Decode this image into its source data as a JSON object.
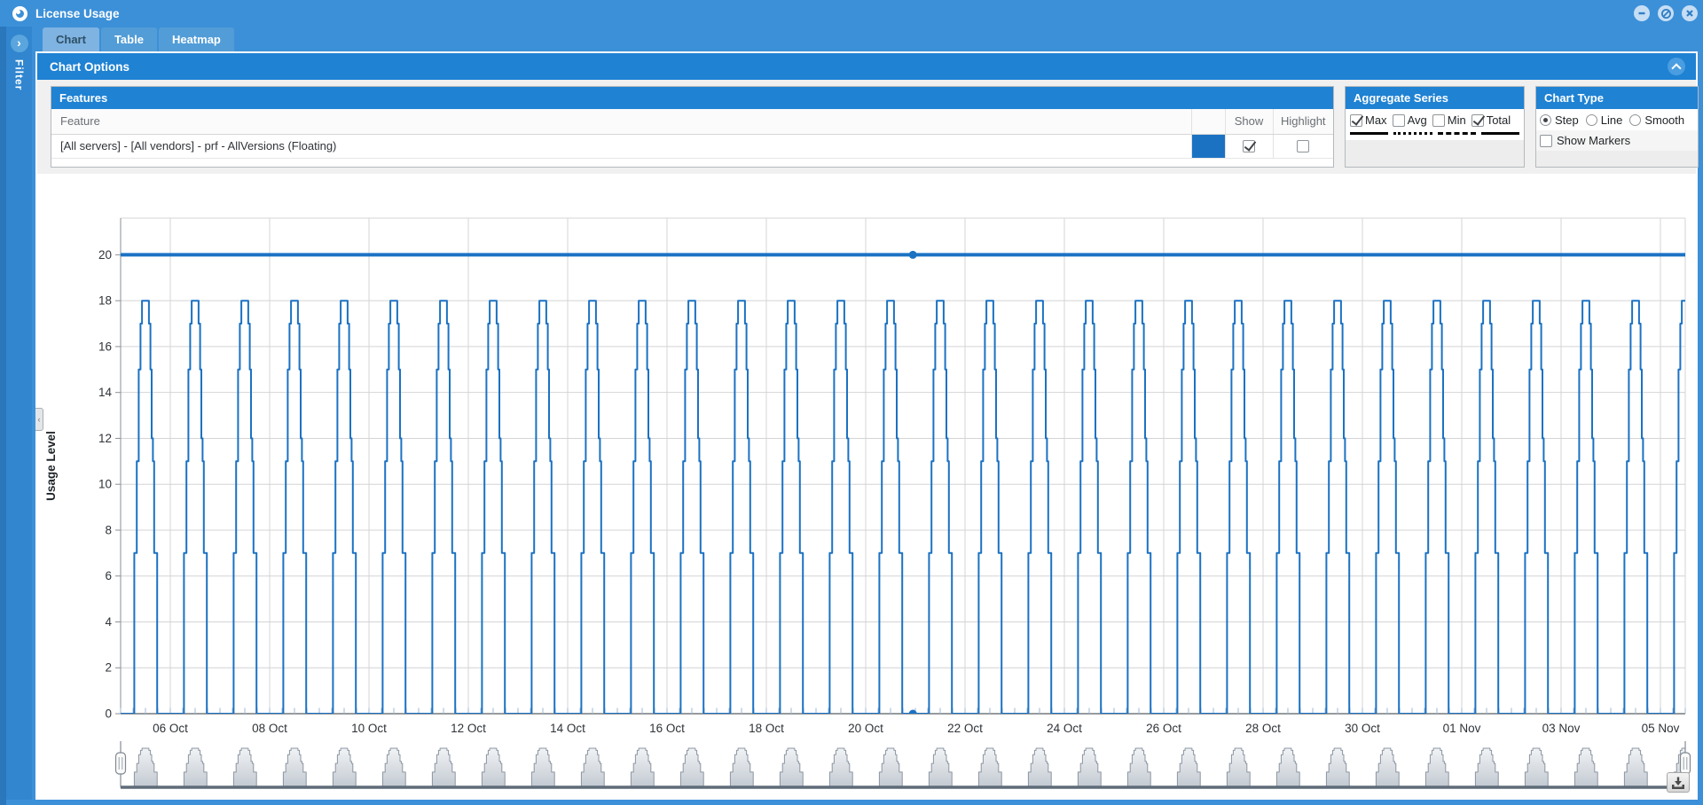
{
  "window": {
    "title": "License Usage",
    "buttons": [
      {
        "name": "minimize"
      },
      {
        "name": "maximize"
      },
      {
        "name": "close"
      }
    ]
  },
  "filter_panel": {
    "label": "Filter",
    "expand_icon": "chevron-right"
  },
  "tabs": [
    {
      "label": "Chart",
      "active": true
    },
    {
      "label": "Table",
      "active": false
    },
    {
      "label": "Heatmap",
      "active": false
    }
  ],
  "chart_options": {
    "title": "Chart Options",
    "collapse_icon": "chevron-up"
  },
  "features_panel": {
    "title": "Features",
    "columns": {
      "feature": "Feature",
      "show": "Show",
      "highlight": "Highlight"
    },
    "rows": [
      {
        "feature": "[All servers] - [All vendors] - prf - AllVersions (Floating)",
        "color": "#1b72c3",
        "show": true,
        "highlight": false
      }
    ]
  },
  "aggregate_panel": {
    "title": "Aggregate Series",
    "options": [
      {
        "label": "Max",
        "checked": true,
        "line_style": "solid"
      },
      {
        "label": "Avg",
        "checked": false,
        "line_style": "dotted"
      },
      {
        "label": "Min",
        "checked": false,
        "line_style": "dashed"
      },
      {
        "label": "Total",
        "checked": true,
        "line_style": "solid"
      }
    ]
  },
  "chart_type_panel": {
    "title": "Chart Type",
    "options": [
      {
        "label": "Step",
        "selected": true
      },
      {
        "label": "Line",
        "selected": false
      },
      {
        "label": "Smooth",
        "selected": false
      }
    ],
    "show_markers": {
      "label": "Show Markers",
      "checked": false
    }
  },
  "chart_data": {
    "type": "line",
    "subtype": "step",
    "title": "",
    "xlabel": "",
    "ylabel": "Usage Level",
    "ylim": [
      0,
      21.6
    ],
    "y_ticks": [
      0,
      2,
      4,
      6,
      8,
      10,
      12,
      14,
      16,
      18,
      20
    ],
    "x_tick_labels": [
      "06 Oct",
      "08 Oct",
      "10 Oct",
      "12 Oct",
      "14 Oct",
      "16 Oct",
      "18 Oct",
      "20 Oct",
      "22 Oct",
      "24 Oct",
      "26 Oct",
      "28 Oct",
      "30 Oct",
      "01 Nov",
      "03 Nov",
      "05 Nov"
    ],
    "x_tick_days": [
      1,
      3,
      5,
      7,
      9,
      11,
      13,
      15,
      17,
      19,
      21,
      23,
      25,
      27,
      29,
      31
    ],
    "x_range_days": [
      0,
      31.5
    ],
    "grid": true,
    "series": [
      {
        "name": "[All servers] - [All vendors] - prf - AllVersions (Floating)",
        "color": "#1b72c3",
        "pattern": "daily_pulse",
        "peak_value": 18
      },
      {
        "name": "Total",
        "color": "#1b72c3",
        "constant_value": 20,
        "width": 4
      }
    ],
    "pulse_profile": [
      [
        0,
        0
      ],
      [
        0.275,
        7
      ],
      [
        0.325,
        11
      ],
      [
        0.365,
        15
      ],
      [
        0.4,
        17
      ],
      [
        0.43,
        18
      ],
      [
        0.57,
        17
      ],
      [
        0.6,
        15
      ],
      [
        0.625,
        12
      ],
      [
        0.65,
        11
      ],
      [
        0.675,
        7
      ],
      [
        0.735,
        0
      ]
    ],
    "num_days": 32,
    "marker": {
      "day": 15.95,
      "values": [
        20,
        0
      ]
    },
    "navigator": {
      "present": true,
      "handle_icon": "range-slider-handle"
    }
  },
  "download_label": "download-chart",
  "colors": {
    "window_blue": "#3c90d8",
    "header_blue": "#1f82d3",
    "series_blue": "#1b72c3",
    "grid_gray": "#d4d4d4"
  }
}
